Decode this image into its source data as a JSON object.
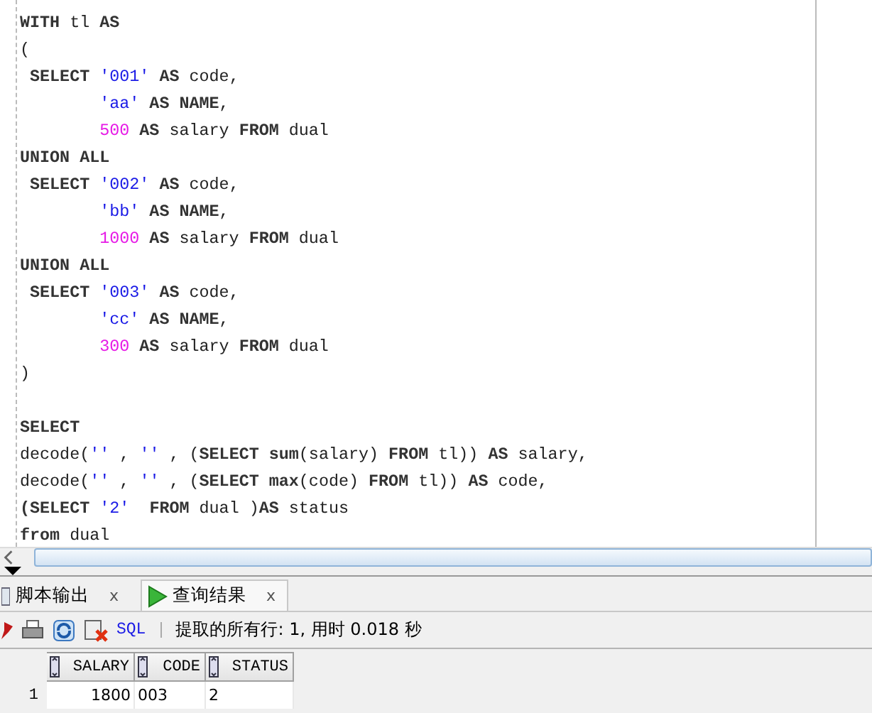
{
  "editor": {
    "lines": [
      {
        "kind": "code",
        "tokens": [
          {
            "kind": "kw",
            "text": "WITH"
          },
          {
            "kind": "plain",
            "text": " tl "
          },
          {
            "kind": "kw",
            "text": "AS"
          }
        ]
      },
      {
        "kind": "code",
        "tokens": [
          {
            "kind": "plain",
            "text": "("
          }
        ]
      },
      {
        "kind": "code",
        "tokens": [
          {
            "kind": "kw",
            "text": " SELECT"
          },
          {
            "kind": "str",
            "text": " '001'"
          },
          {
            "kind": "kw",
            "text": " AS"
          },
          {
            "kind": "plain",
            "text": " code,"
          }
        ]
      },
      {
        "kind": "code",
        "tokens": [
          {
            "kind": "str",
            "text": "        'aa'"
          },
          {
            "kind": "kw",
            "text": " AS NAME"
          },
          {
            "kind": "plain",
            "text": ","
          }
        ]
      },
      {
        "kind": "code",
        "tokens": [
          {
            "kind": "num",
            "text": "        500"
          },
          {
            "kind": "kw",
            "text": " AS"
          },
          {
            "kind": "plain",
            "text": " salary "
          },
          {
            "kind": "kw",
            "text": "FROM"
          },
          {
            "kind": "plain",
            "text": " dual"
          }
        ]
      },
      {
        "kind": "code",
        "tokens": [
          {
            "kind": "kw",
            "text": "UNION ALL"
          }
        ]
      },
      {
        "kind": "code",
        "tokens": [
          {
            "kind": "kw",
            "text": " SELECT"
          },
          {
            "kind": "str",
            "text": " '002'"
          },
          {
            "kind": "kw",
            "text": " AS"
          },
          {
            "kind": "plain",
            "text": " code,"
          }
        ]
      },
      {
        "kind": "code",
        "tokens": [
          {
            "kind": "str",
            "text": "        'bb'"
          },
          {
            "kind": "kw",
            "text": " AS NAME"
          },
          {
            "kind": "plain",
            "text": ","
          }
        ]
      },
      {
        "kind": "code",
        "tokens": [
          {
            "kind": "num",
            "text": "        1000"
          },
          {
            "kind": "kw",
            "text": " AS"
          },
          {
            "kind": "plain",
            "text": " salary "
          },
          {
            "kind": "kw",
            "text": "FROM"
          },
          {
            "kind": "plain",
            "text": " dual"
          }
        ]
      },
      {
        "kind": "code",
        "tokens": [
          {
            "kind": "kw",
            "text": "UNION ALL"
          }
        ]
      },
      {
        "kind": "code",
        "tokens": [
          {
            "kind": "kw",
            "text": " SELECT"
          },
          {
            "kind": "str",
            "text": " '003'"
          },
          {
            "kind": "kw",
            "text": " AS"
          },
          {
            "kind": "plain",
            "text": " code,"
          }
        ]
      },
      {
        "kind": "code",
        "tokens": [
          {
            "kind": "str",
            "text": "        'cc'"
          },
          {
            "kind": "kw",
            "text": " AS NAME"
          },
          {
            "kind": "plain",
            "text": ","
          }
        ]
      },
      {
        "kind": "code",
        "tokens": [
          {
            "kind": "num",
            "text": "        300"
          },
          {
            "kind": "kw",
            "text": " AS"
          },
          {
            "kind": "plain",
            "text": " salary "
          },
          {
            "kind": "kw",
            "text": "FROM"
          },
          {
            "kind": "plain",
            "text": " dual"
          }
        ]
      },
      {
        "kind": "code",
        "tokens": [
          {
            "kind": "plain",
            "text": ")"
          }
        ]
      },
      {
        "kind": "blank"
      },
      {
        "kind": "code",
        "tokens": [
          {
            "kind": "kw",
            "text": "SELECT"
          }
        ]
      },
      {
        "kind": "code",
        "tokens": [
          {
            "kind": "plain",
            "text": "decode("
          },
          {
            "kind": "str",
            "text": "''"
          },
          {
            "kind": "plain",
            "text": " , "
          },
          {
            "kind": "str",
            "text": "''"
          },
          {
            "kind": "plain",
            "text": " , ("
          },
          {
            "kind": "kw",
            "text": "SELECT sum"
          },
          {
            "kind": "plain",
            "text": "(salary) "
          },
          {
            "kind": "kw",
            "text": "FROM"
          },
          {
            "kind": "plain",
            "text": " tl)) "
          },
          {
            "kind": "kw",
            "text": "AS"
          },
          {
            "kind": "plain",
            "text": " salary,"
          }
        ]
      },
      {
        "kind": "code",
        "tokens": [
          {
            "kind": "plain",
            "text": "decode("
          },
          {
            "kind": "str",
            "text": "''"
          },
          {
            "kind": "plain",
            "text": " , "
          },
          {
            "kind": "str",
            "text": "''"
          },
          {
            "kind": "plain",
            "text": " , ("
          },
          {
            "kind": "kw",
            "text": "SELECT max"
          },
          {
            "kind": "plain",
            "text": "(code) "
          },
          {
            "kind": "kw",
            "text": "FROM"
          },
          {
            "kind": "plain",
            "text": " tl)) "
          },
          {
            "kind": "kw",
            "text": "AS"
          },
          {
            "kind": "plain",
            "text": " code,"
          }
        ]
      },
      {
        "kind": "code",
        "tokens": [
          {
            "kind": "kw",
            "text": "(SELECT"
          },
          {
            "kind": "str",
            "text": " '2'"
          },
          {
            "kind": "kw",
            "text": "  FROM"
          },
          {
            "kind": "plain",
            "text": " dual )"
          },
          {
            "kind": "kw",
            "text": "AS"
          },
          {
            "kind": "plain",
            "text": " status"
          }
        ]
      },
      {
        "kind": "code",
        "tokens": [
          {
            "kind": "kw",
            "text": "from"
          },
          {
            "kind": "plain",
            "text": " dual"
          }
        ]
      }
    ]
  },
  "tabs": [
    {
      "label": "脚本输出",
      "close": "x",
      "kind": "script",
      "selected": false
    },
    {
      "label": "查询结果",
      "close": "x",
      "kind": "query",
      "selected": true
    }
  ],
  "toolbar": {
    "sql_link": "SQL",
    "status": "提取的所有行: 1, 用时 0.018 秒"
  },
  "grid": {
    "columns": [
      "SALARY",
      "CODE",
      "STATUS"
    ],
    "rows": [
      {
        "number": "1",
        "cells": [
          "1800",
          "003",
          "2"
        ]
      }
    ]
  }
}
